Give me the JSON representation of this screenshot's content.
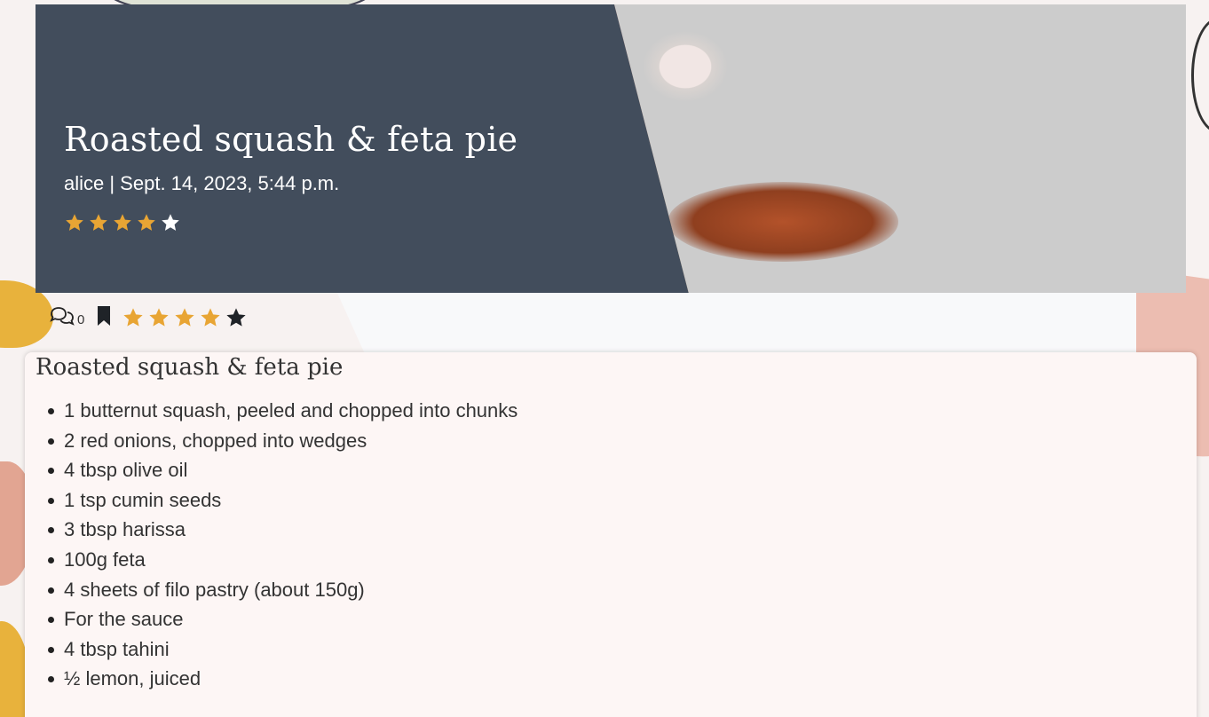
{
  "recipe": {
    "title": "Roasted squash & feta pie",
    "author": "alice",
    "date": "Sept. 14, 2023, 5:44 p.m.",
    "meta_line": "alice | Sept. 14, 2023, 5:44 p.m.",
    "average_rating": 4,
    "average_rating_max": 5
  },
  "actions": {
    "comment_count": "0",
    "user_rating": 4,
    "user_rating_max": 5
  },
  "ingredients_card": {
    "title": "Roasted squash & feta pie",
    "items": [
      "1 butternut squash, peeled and chopped into chunks",
      "2 red onions, chopped into wedges",
      "4 tbsp olive oil",
      "1 tsp cumin seeds",
      "3 tbsp harissa",
      "100g feta",
      "4 sheets of filo pastry (about 150g)",
      "For the sauce",
      "4 tbsp tahini",
      "½ lemon, juiced"
    ]
  },
  "colors": {
    "banner": "#424d5c",
    "star_filled": "#e8a534",
    "star_empty_banner": "#ffffff",
    "star_empty_bar": "#1f2328",
    "card_bg": "#fdf6f5"
  },
  "icons": {
    "comment": "comments-icon",
    "bookmark": "bookmark-icon",
    "star": "star-icon"
  }
}
